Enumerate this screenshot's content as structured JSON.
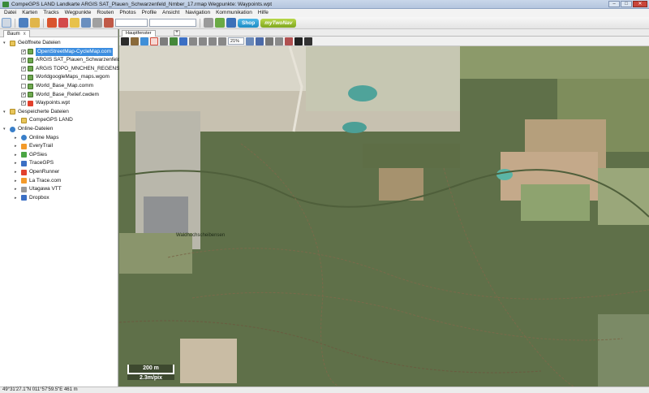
{
  "window": {
    "title": "CompeGPS LAND Landkarte ARGIS SAT_Plauen_Schwarzenfeld_Nmber_17.rmap Wegpunkte: Waypoints.wpt",
    "controls": [
      "–",
      "□",
      "✕"
    ]
  },
  "menu": [
    "Datei",
    "Karten",
    "Tracks",
    "Wegpunkte",
    "Routen",
    "Photos",
    "Profile",
    "Ansicht",
    "Navigation",
    "Kommunikation",
    "Hilfe"
  ],
  "toolbar": {
    "shop_label": "Shop",
    "mytwonav_label": "myTwoNav"
  },
  "panel": {
    "tab_label": "Baum",
    "tab_close": "x",
    "tree": [
      {
        "label": "Geöffnete Dateien",
        "level": 0,
        "expander": "▾",
        "icon": "folder-icon",
        "cls": "folder"
      },
      {
        "label": "OpenStreetMap-CycleMap.com",
        "level": 1,
        "check": true,
        "icon": "map-icon",
        "cls": "map",
        "selected": true
      },
      {
        "label": "ARGIS SAT_Plauen_Schwarzenfeld_N",
        "level": 1,
        "check": true,
        "icon": "map-icon",
        "cls": "map"
      },
      {
        "label": "ARGIS TOPO_MNCHEN_REGENSBURG",
        "level": 1,
        "check": true,
        "icon": "map-icon",
        "cls": "map"
      },
      {
        "label": "WorldgoogleMaps_maps.wgom",
        "level": 1,
        "check": false,
        "icon": "map-icon",
        "cls": "map"
      },
      {
        "label": "World_Base_Map.comm",
        "level": 1,
        "check": false,
        "icon": "map-icon",
        "cls": "map"
      },
      {
        "label": "World_Base_Relief.cwdem",
        "level": 1,
        "check": true,
        "icon": "map-icon",
        "cls": "map"
      },
      {
        "label": "Waypoints.wpt",
        "level": 1,
        "check": true,
        "icon": "waypoint-icon",
        "cls": "track"
      },
      {
        "label": "Gespeicherte Dateien",
        "level": 0,
        "expander": "▾",
        "icon": "folder-icon",
        "cls": "folder"
      },
      {
        "label": "CompeGPS LAND",
        "level": 1,
        "expander": "▸",
        "icon": "folder-icon",
        "cls": "folder"
      },
      {
        "label": "Online-Dateien",
        "level": 0,
        "expander": "▾",
        "icon": "globe-icon",
        "cls": "globe"
      },
      {
        "label": "Online Maps",
        "level": 1,
        "expander": "▸",
        "icon": "globe-icon",
        "cls": "globe"
      },
      {
        "label": "EveryTrail",
        "level": 1,
        "expander": "▸",
        "icon": "everytrail-icon",
        "cls": "orange"
      },
      {
        "label": "GPSies",
        "level": 1,
        "expander": "▸",
        "icon": "gpsies-icon",
        "cls": "green"
      },
      {
        "label": "TraceGPS",
        "level": 1,
        "expander": "▸",
        "icon": "tracegps-icon",
        "cls": "blue"
      },
      {
        "label": "OpenRunner",
        "level": 1,
        "expander": "▸",
        "icon": "openrunner-icon",
        "cls": "track"
      },
      {
        "label": "La Trace.com",
        "level": 1,
        "expander": "▸",
        "icon": "latrace-icon",
        "cls": "orange"
      },
      {
        "label": "Utagawa VTT",
        "level": 1,
        "expander": "▸",
        "icon": "utagawa-icon",
        "cls": "gray"
      },
      {
        "label": "Dropbox",
        "level": 1,
        "expander": "▸",
        "icon": "dropbox-icon",
        "cls": "blue"
      }
    ]
  },
  "map": {
    "tab_label": "Hauptfenster",
    "tab_add": "+",
    "zoom": "21%",
    "place_label": "Waldhochscheibensen",
    "scale_distance": "200 m",
    "scale_resolution": "2.3m/pix"
  },
  "status": {
    "text": "49°31'27.1\"N 011°57'59.5\"E  461 m"
  }
}
